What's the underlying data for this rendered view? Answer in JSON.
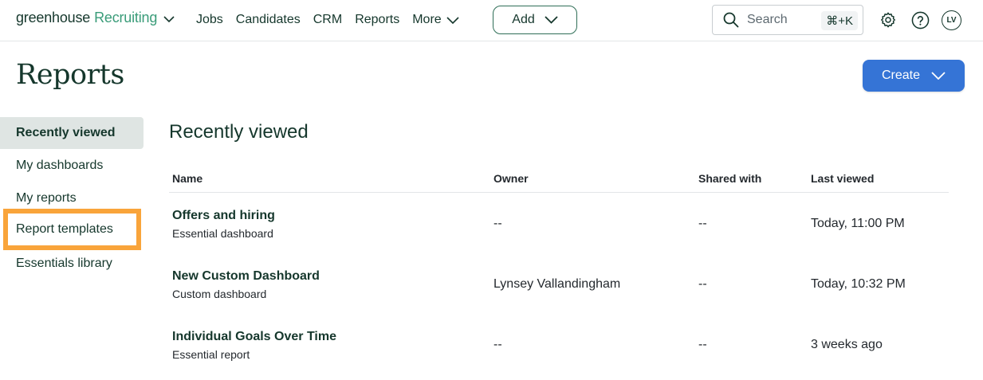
{
  "brand": {
    "name": "greenhouse",
    "product": "Recruiting"
  },
  "nav": {
    "links": [
      "Jobs",
      "Candidates",
      "CRM",
      "Reports"
    ],
    "more_label": "More",
    "add_label": "Add",
    "search_placeholder": "Search",
    "search_shortcut": "⌘+K",
    "avatar_initials": "LV"
  },
  "page": {
    "title": "Reports",
    "create_label": "Create"
  },
  "sidebar": {
    "items": [
      {
        "label": "Recently viewed"
      },
      {
        "label": "My dashboards"
      },
      {
        "label": "My reports"
      },
      {
        "label": "Report templates"
      },
      {
        "label": "Essentials library"
      }
    ]
  },
  "content": {
    "section_title": "Recently viewed",
    "columns": [
      "Name",
      "Owner",
      "Shared with",
      "Last viewed"
    ],
    "rows": [
      {
        "name": "Offers and hiring",
        "type": "Essential dashboard",
        "owner": "--",
        "shared": "--",
        "last_viewed": "Today, 11:00 PM"
      },
      {
        "name": "New Custom Dashboard",
        "type": "Custom dashboard",
        "owner": "Lynsey Vallandingham",
        "shared": "--",
        "last_viewed": "Today, 10:32 PM"
      },
      {
        "name": "Individual Goals Over Time",
        "type": "Essential report",
        "owner": "--",
        "shared": "--",
        "last_viewed": "3 weeks ago"
      }
    ]
  },
  "colors": {
    "primary": "#3574d6",
    "brand_dark": "#15372c",
    "brand_green": "#3a9c79",
    "highlight": "#f9a43a",
    "active_bg": "#dfe5e3"
  },
  "icons": [
    "chevron-down-icon",
    "search-icon",
    "gear-icon",
    "help-icon"
  ]
}
